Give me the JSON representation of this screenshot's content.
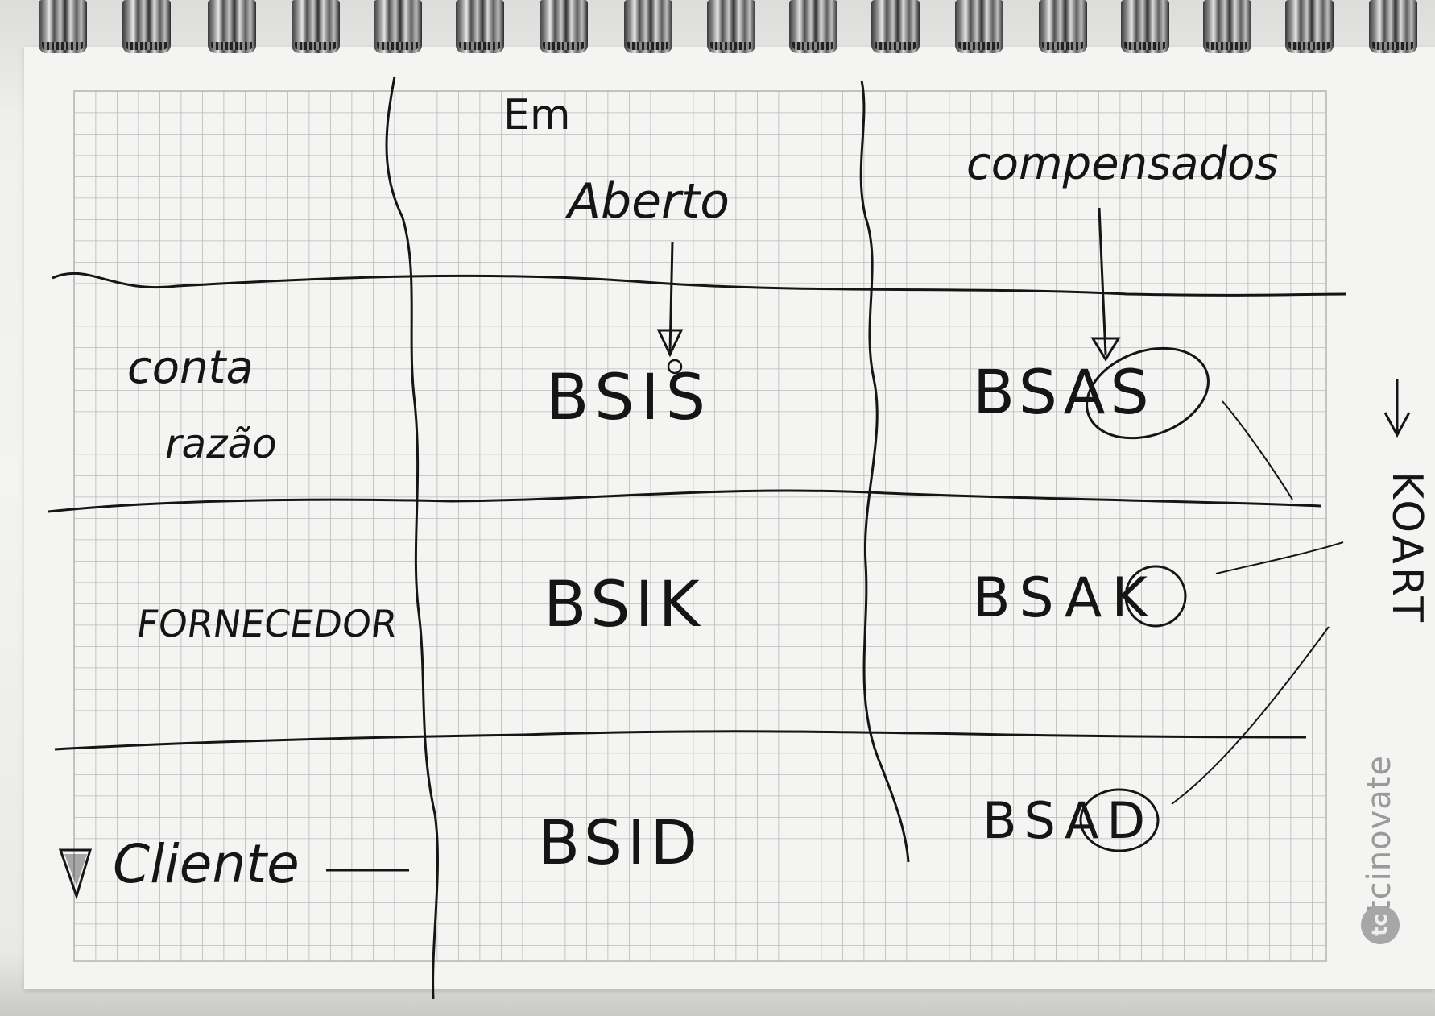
{
  "notebook": {
    "header": {
      "em": "Em",
      "aberto": "Aberto",
      "compensados": "compensados"
    },
    "rows": [
      {
        "label_lines": [
          "conta",
          "razão"
        ],
        "open_table": "BSIS",
        "cleared_table": "BSAS"
      },
      {
        "label_lines": [
          "FORNECEDOR"
        ],
        "open_table": "BSIK",
        "cleared_table": "BSAK"
      },
      {
        "label_lines": [
          "Cliente"
        ],
        "open_table": "BSID",
        "cleared_table": "BSAD"
      }
    ],
    "side_note": "KOART",
    "watermark": "tcinovate"
  },
  "colors": {
    "ink": "#151515",
    "grid": "#b9b9b9",
    "paper": "#f4f4f2",
    "watermark": "#9a9a9a"
  }
}
